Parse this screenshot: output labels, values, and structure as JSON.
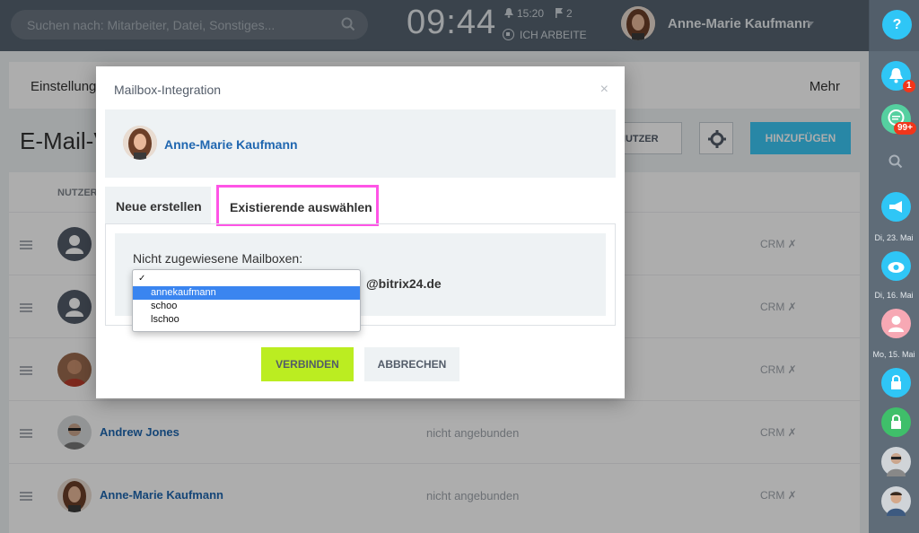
{
  "header": {
    "search_placeholder": "Suchen nach: Mitarbeiter, Datei, Sonstiges...",
    "clock": "09:44",
    "alarm_time": "15:20",
    "flag_count": "2",
    "work_status": "ICH ARBEITE",
    "user_name": "Anne-Marie Kaufmann"
  },
  "sidebar": {
    "help": "?",
    "notifications_badge": "1",
    "chat_badge": "99+",
    "dates": [
      "Di, 23. Mai",
      "Di, 16. Mai",
      "Mo, 15. Mai"
    ]
  },
  "page": {
    "nav_left": "Einstellung",
    "nav_right": "Mehr",
    "title": "E-Mail-V",
    "filter_button": "NUTZER",
    "add_button": "HINZUFÜGEN",
    "column_header": "NUTZER",
    "rows": [
      {
        "name": "",
        "status": "",
        "crm": "CRM ✗"
      },
      {
        "name": "",
        "status": "",
        "crm": "CRM ✗"
      },
      {
        "name": "",
        "status": "",
        "crm": "CRM ✗"
      },
      {
        "name": "Andrew Jones",
        "status": "nicht angebunden",
        "crm": "CRM ✗"
      },
      {
        "name": "Anne-Marie Kaufmann",
        "status": "nicht angebunden",
        "crm": "CRM ✗"
      }
    ]
  },
  "modal": {
    "title": "Mailbox-Integration",
    "close": "×",
    "user_name": "Anne-Marie Kaufmann",
    "tab_new": "Neue erstellen",
    "tab_existing": "Existierende auswählen",
    "mailbox_label": "Nicht zugewiesene Mailboxen:",
    "domain": "@bitrix24.de",
    "options": [
      "",
      "annekaufmann",
      "schoo",
      "lschoo"
    ],
    "selected_index": 1,
    "connect_button": "VERBINDEN",
    "cancel_button": "ABBRECHEN"
  },
  "colors": {
    "header_bg": "#566370",
    "accent_blue": "#3bc8f5",
    "connect_green": "#bbed21",
    "highlight_magenta": "#ff54e6",
    "link_blue": "#2067b0"
  }
}
